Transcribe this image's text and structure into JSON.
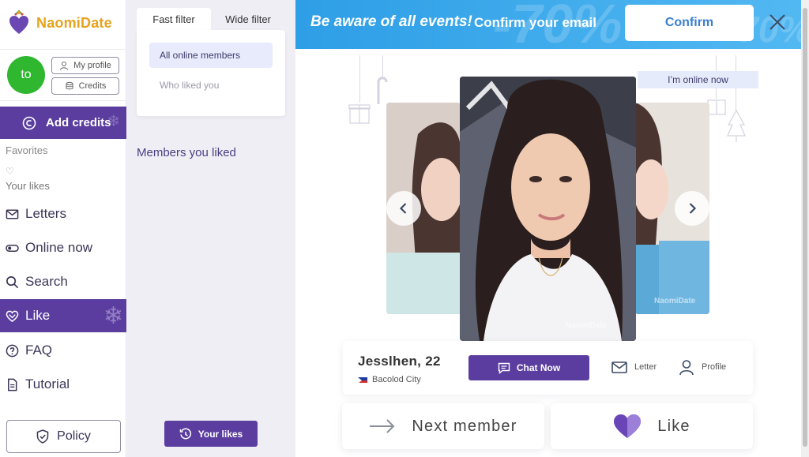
{
  "brand": {
    "name": "NaomiDate"
  },
  "sidebar": {
    "avatar_initials": "to",
    "my_profile_label": "My profile",
    "credits_label": "Credits",
    "add_credits_label": "Add credits",
    "favorites_title": "Favorites",
    "your_likes_label": "Your likes",
    "nav": [
      {
        "label": "Letters",
        "icon": "envelope-icon"
      },
      {
        "label": "Online now",
        "icon": "toggle-icon"
      },
      {
        "label": "Search",
        "icon": "search-icon"
      },
      {
        "label": "Like",
        "icon": "heart-icon",
        "active": true
      },
      {
        "label": "FAQ",
        "icon": "question-icon"
      },
      {
        "label": "Tutorial",
        "icon": "document-icon"
      }
    ],
    "policy_label": "Policy"
  },
  "filters": {
    "tabs": [
      "Fast filter",
      "Wide filter"
    ],
    "active_tab": "Fast filter",
    "options": [
      "All online members",
      "Who liked you"
    ],
    "selected_option": "All online members",
    "members_liked_title": "Members you liked",
    "your_likes_button": "Your likes"
  },
  "banner": {
    "headline": "Be aware of all events!",
    "text": "Confirm your email",
    "confirm_label": "Confirm",
    "decor_text": "-70%"
  },
  "member": {
    "online_status": "I’m online now",
    "name": "Jesslhen, 22",
    "city": "Bacolod City",
    "country_flag": "philippines",
    "chat_label": "Chat Now",
    "letter_label": "Letter",
    "profile_label": "Profile",
    "watermark": "NaomiDate"
  },
  "actions": {
    "next_label": "Next member",
    "like_label": "Like"
  },
  "colors": {
    "brand_purple": "#5b3da0",
    "brand_orange": "#e6a21c",
    "banner_blue": "#3aa8ec",
    "online_green": "#2fb82f"
  }
}
